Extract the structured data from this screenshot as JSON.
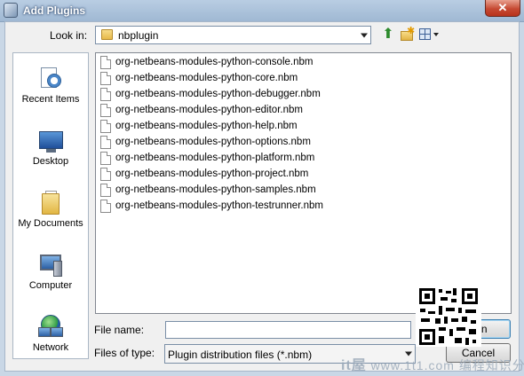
{
  "window": {
    "title": "Add Plugins",
    "close_glyph": "✕"
  },
  "lookin": {
    "label": "Look in:",
    "value": "nbplugin"
  },
  "toolbar": {
    "up_icon": "up-folder-icon",
    "newfolder_icon": "new-folder-icon",
    "view_icon": "view-menu-icon"
  },
  "places": [
    {
      "label": "Recent Items",
      "icon": "recent-items-icon"
    },
    {
      "label": "Desktop",
      "icon": "desktop-icon"
    },
    {
      "label": "My Documents",
      "icon": "my-documents-icon"
    },
    {
      "label": "Computer",
      "icon": "computer-icon"
    },
    {
      "label": "Network",
      "icon": "network-icon"
    }
  ],
  "files": [
    "org-netbeans-modules-python-console.nbm",
    "org-netbeans-modules-python-core.nbm",
    "org-netbeans-modules-python-debugger.nbm",
    "org-netbeans-modules-python-editor.nbm",
    "org-netbeans-modules-python-help.nbm",
    "org-netbeans-modules-python-options.nbm",
    "org-netbeans-modules-python-platform.nbm",
    "org-netbeans-modules-python-project.nbm",
    "org-netbeans-modules-python-samples.nbm",
    "org-netbeans-modules-python-testrunner.nbm"
  ],
  "filename": {
    "label": "File name:",
    "value": ""
  },
  "filetype": {
    "label": "Files of type:",
    "value": "Plugin distribution files (*.nbm)"
  },
  "buttons": {
    "open": "pen",
    "cancel": "Cancel"
  },
  "watermark": {
    "prefix": "it屋",
    "text": "www.1t1.com",
    "site": "编程知识分享"
  }
}
